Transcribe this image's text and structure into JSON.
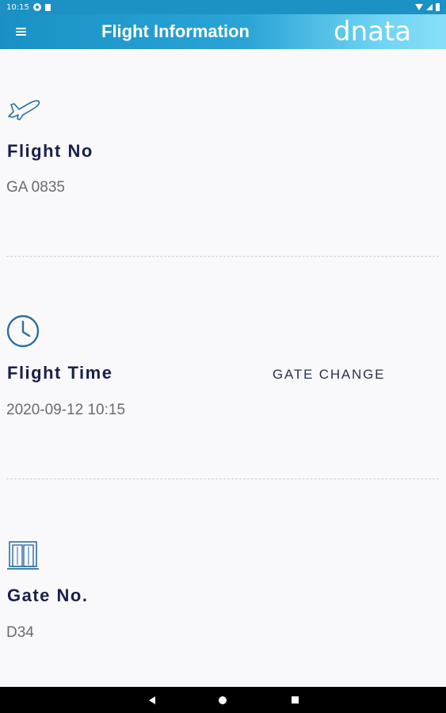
{
  "status_bar": {
    "time": "10:15",
    "icons": [
      "g-icon",
      "sim-icon",
      "wifi-icon",
      "signal-icon",
      "battery-icon"
    ]
  },
  "app_bar": {
    "title": "Flight Information",
    "brand": "dnata",
    "menu_icon": "hamburger-menu-icon"
  },
  "flight_no": {
    "icon": "airplane-icon",
    "label": "Flight No",
    "value": "GA 0835"
  },
  "flight_time": {
    "icon": "clock-icon",
    "label": "Flight Time",
    "value": "2020-09-12 10:15",
    "notice": "GATE CHANGE"
  },
  "gate_no": {
    "icon": "gate-icon",
    "label": "Gate No.",
    "value": "D34"
  },
  "nav_bar": {
    "buttons": [
      "back-icon",
      "home-icon",
      "recents-icon"
    ]
  },
  "colors": {
    "app_bar_start": "#1991c6",
    "app_bar_end": "#87e0f8",
    "label": "#1a1f4a",
    "value": "#6b6b6f",
    "icon": "#2a6ea3",
    "background": "#f9f9fb"
  }
}
